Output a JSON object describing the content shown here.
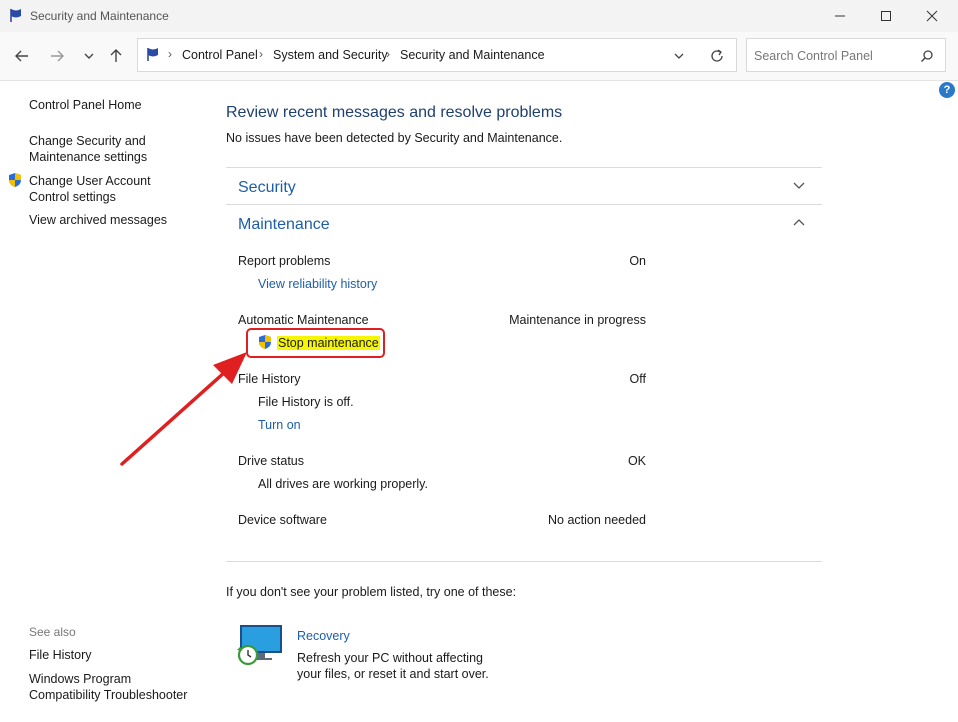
{
  "window": {
    "title": "Security and Maintenance",
    "minimize_icon": "minimize-icon",
    "maximize_icon": "maximize-icon",
    "close_icon": "close-icon"
  },
  "nav": {
    "back_icon": "arrow-left-icon",
    "forward_icon": "arrow-right-icon",
    "recent_icon": "chevron-down-icon",
    "up_icon": "arrow-up-icon",
    "breadcrumbs": [
      "Control Panel",
      "System and Security",
      "Security and Maintenance"
    ],
    "search_placeholder": "Search Control Panel"
  },
  "sidebar": {
    "home": "Control Panel Home",
    "links": [
      {
        "label": "Change Security and Maintenance settings"
      },
      {
        "label": "Change User Account Control settings"
      },
      {
        "label": "View archived messages"
      }
    ],
    "see_also_title": "See also",
    "see_also": [
      {
        "label": "File History"
      },
      {
        "label": "Windows Program Compatibility Troubleshooter"
      }
    ]
  },
  "main": {
    "heading": "Review recent messages and resolve problems",
    "subtext": "No issues have been detected by Security and Maintenance.",
    "security_title": "Security",
    "maintenance_title": "Maintenance",
    "items": [
      {
        "label": "Report problems",
        "status": "On",
        "link": "View reliability history"
      },
      {
        "label": "Automatic Maintenance",
        "status": "Maintenance in progress",
        "link": "Stop maintenance"
      },
      {
        "label": "File History",
        "status": "Off",
        "detail": "File History is off.",
        "link": "Turn on"
      },
      {
        "label": "Drive status",
        "status": "OK",
        "detail": "All drives are working properly."
      },
      {
        "label": "Device software",
        "status": "No action needed"
      }
    ],
    "suggest": "If you don't see your problem listed, try one of these:",
    "recovery": {
      "title": "Recovery",
      "description": "Refresh your PC without affecting your files, or reset it and start over."
    }
  },
  "colors": {
    "link": "#1e5ea8",
    "heading": "#1e3f70",
    "highlight": "#f6f600",
    "annotation": "#e02020"
  }
}
